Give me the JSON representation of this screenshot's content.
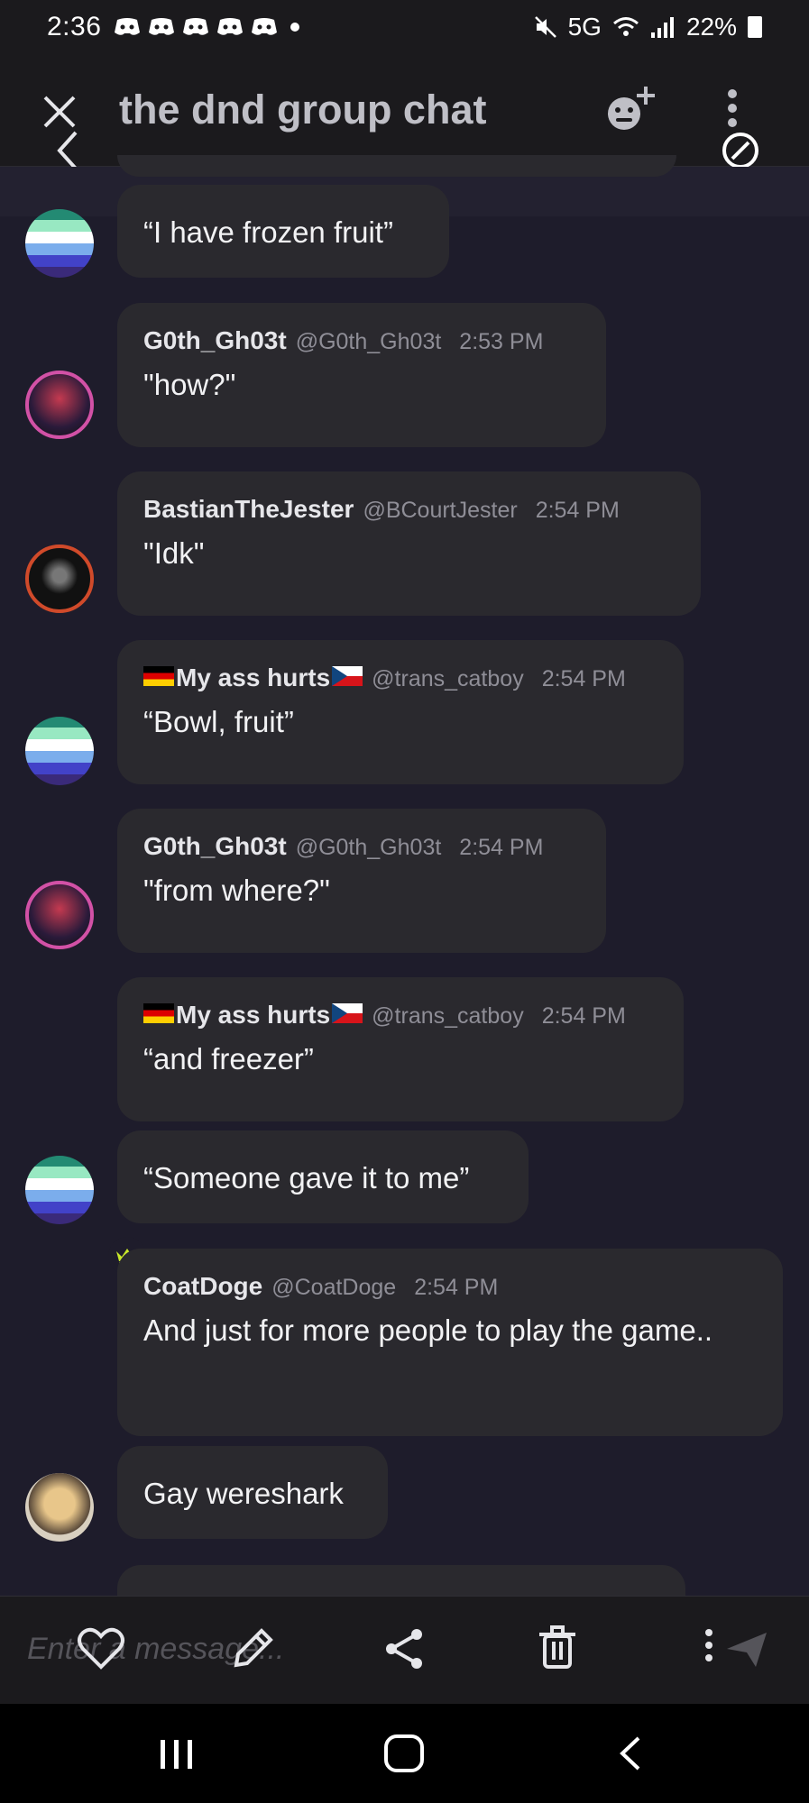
{
  "status_bar": {
    "time": "2:36",
    "signal": "5G",
    "battery": "22%"
  },
  "header": {
    "title": "the dnd group chat"
  },
  "messages": [
    {
      "author": "",
      "handle": "",
      "time": "",
      "text": "“I have frozen fruit”"
    },
    {
      "author": "G0th_Gh03t",
      "handle": "@G0th_Gh03t",
      "time": "2:53 PM",
      "text": "\"how?\""
    },
    {
      "author": "BastianTheJester",
      "handle": "@BCourtJester",
      "time": "2:54 PM",
      "text": "\"Idk\""
    },
    {
      "author": "My ass hurts",
      "handle": "@trans_catboy",
      "time": "2:54 PM",
      "text": "“Bowl, fruit”"
    },
    {
      "author": "G0th_Gh03t",
      "handle": "@G0th_Gh03t",
      "time": "2:54 PM",
      "text": "\"from where?\""
    },
    {
      "author": "My ass hurts",
      "handle": "@trans_catboy",
      "time": "2:54 PM",
      "text": "“and freezer”"
    },
    {
      "author": "",
      "handle": "",
      "time": "",
      "text": "“Someone gave it to me”"
    },
    {
      "author": "CoatDoge",
      "handle": "@CoatDoge",
      "time": "2:54 PM",
      "text": "And just for more people to play the game.."
    },
    {
      "author": "",
      "handle": "",
      "time": "",
      "text": "Gay wereshark"
    }
  ],
  "composer": {
    "placeholder": "Enter a message..."
  },
  "icons": {
    "close": "close-icon",
    "back": "back-arrow-icon",
    "add_member": "add-member-icon",
    "more": "more-vertical-icon",
    "sync": "sync-icon",
    "like": "heart-icon",
    "edit": "pencil-icon",
    "share": "share-icon",
    "delete": "trash-icon",
    "send": "send-icon"
  },
  "colors": {
    "background": "#1e1c2b",
    "bubble": "#2a292e",
    "header": "#1b1a1d",
    "crown": "#c8e82a"
  }
}
